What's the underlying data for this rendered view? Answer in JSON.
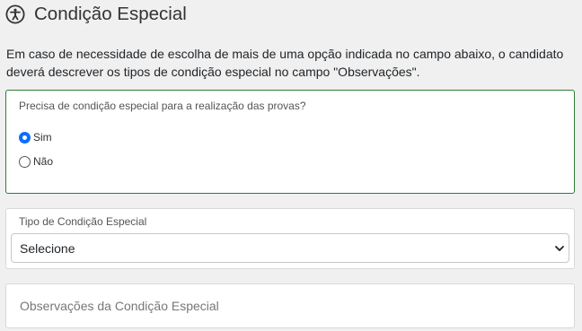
{
  "header": {
    "title": "Condição Especial",
    "icon": "accessibility-icon"
  },
  "intro": {
    "text": "Em caso de necessidade de escolha de mais de uma opção indicada no campo abaixo, o candidato deverá descrever os tipos de condição especial no campo \"Observações\"."
  },
  "question": {
    "label": "Precisa de condição especial para a realização das provas?",
    "options": [
      {
        "label": "Sim",
        "checked": true
      },
      {
        "label": "Não",
        "checked": false
      }
    ]
  },
  "tipo": {
    "label": "Tipo de Condição Especial",
    "value": "Selecione"
  },
  "observacoes": {
    "placeholder": "Observações da Condição Especial"
  },
  "colors": {
    "accent": "#0d6efd",
    "border_success": "#2e7d32"
  }
}
